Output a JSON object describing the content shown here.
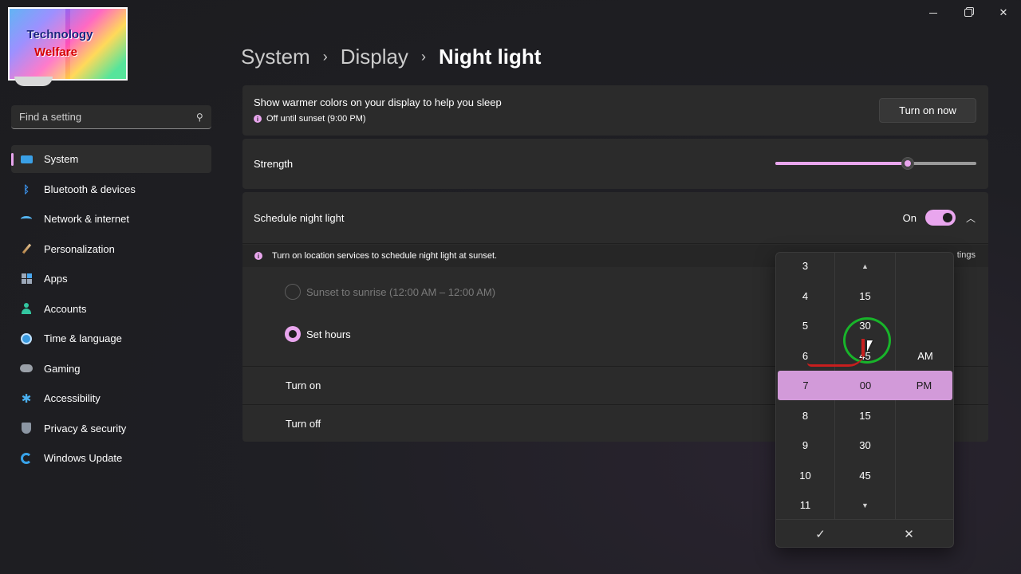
{
  "window": {
    "minimize": "—",
    "maximize": "",
    "close": "✕"
  },
  "logo": {
    "line1": "Technology",
    "line2": "Welfare"
  },
  "search": {
    "placeholder": "Find a setting"
  },
  "sidebar": {
    "items": [
      {
        "label": "System",
        "icon": "system-icon",
        "active": true
      },
      {
        "label": "Bluetooth & devices",
        "icon": "bluetooth-icon"
      },
      {
        "label": "Network & internet",
        "icon": "wifi-icon"
      },
      {
        "label": "Personalization",
        "icon": "brush-icon"
      },
      {
        "label": "Apps",
        "icon": "apps-icon"
      },
      {
        "label": "Accounts",
        "icon": "accounts-icon"
      },
      {
        "label": "Time & language",
        "icon": "clock-globe-icon"
      },
      {
        "label": "Gaming",
        "icon": "gamepad-icon"
      },
      {
        "label": "Accessibility",
        "icon": "accessibility-icon"
      },
      {
        "label": "Privacy & security",
        "icon": "shield-icon"
      },
      {
        "label": "Windows Update",
        "icon": "update-icon"
      }
    ]
  },
  "breadcrumb": {
    "part1": "System",
    "part2": "Display",
    "current": "Night light",
    "separator": "›"
  },
  "night_light": {
    "description": "Show warmer colors on your display to help you sleep",
    "status": "Off until sunset (9:00 PM)",
    "turn_on_button": "Turn on now",
    "strength_label": "Strength",
    "strength_value": 0.66,
    "schedule_label": "Schedule night light",
    "schedule_state": "On",
    "location_notice": "Turn on location services to schedule night light at sunset.",
    "location_link": "tings",
    "option_sunset": "Sunset to sunrise (12:00 AM – 12:00 AM)",
    "option_set_hours": "Set hours",
    "turn_on_label": "Turn on",
    "turn_off_label": "Turn off"
  },
  "time_picker": {
    "hours": [
      "3",
      "4",
      "5",
      "6",
      "7",
      "8",
      "9",
      "10",
      "11"
    ],
    "minutes": [
      "",
      "15",
      "30",
      "45",
      "00",
      "15",
      "30",
      "45",
      ""
    ],
    "period_am": "AM",
    "selected": {
      "hour": "7",
      "minute": "00",
      "period": "PM"
    },
    "up_arrow": "▲",
    "down_arrow": "▼",
    "accept": "✓",
    "dismiss": "✕"
  },
  "colors": {
    "accent": "#e9a6ee",
    "card": "#2b2b2b",
    "background": "#1f1f24"
  }
}
